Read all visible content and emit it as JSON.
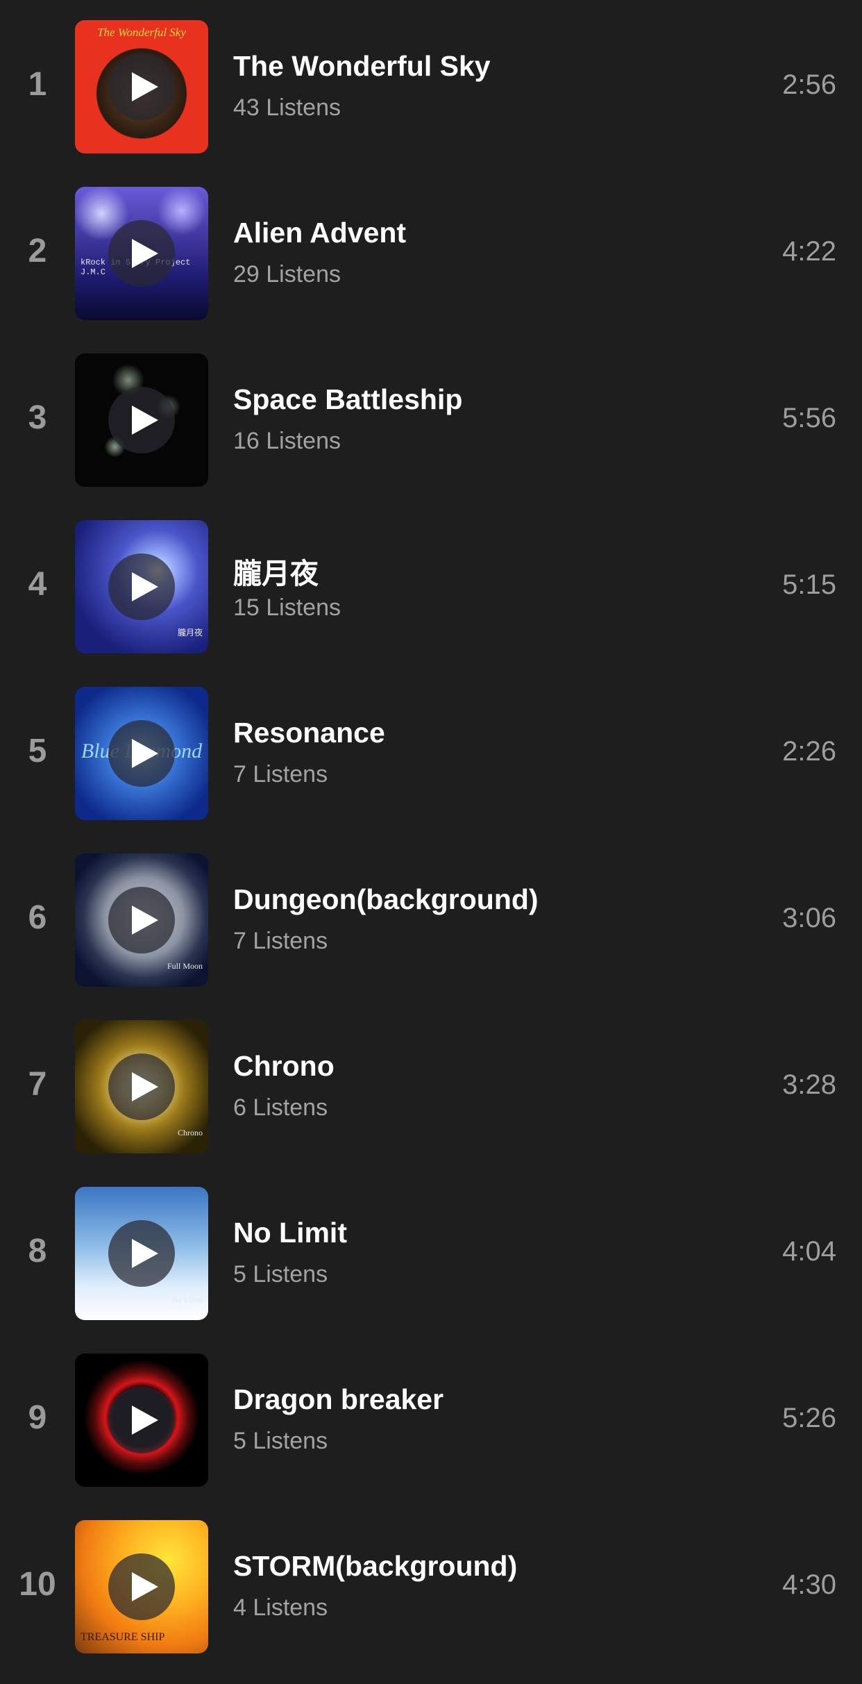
{
  "tracks": [
    {
      "rank": "1",
      "title": "The Wonderful Sky",
      "listens": "43 Listens",
      "duration": "2:56",
      "art": {
        "caption": "The Wonderful Sky",
        "sub": "",
        "colors": [
          "#e8321f",
          "#2a1a10"
        ]
      }
    },
    {
      "rank": "2",
      "title": "Alien Advent",
      "listens": "29 Listens",
      "duration": "4:22",
      "art": {
        "caption": "",
        "sub": "kRock in Story Project J.M.C",
        "colors": [
          "#1c1a6e",
          "#6a5ad8"
        ]
      }
    },
    {
      "rank": "3",
      "title": "Space Battleship",
      "listens": "16 Listens",
      "duration": "5:56",
      "art": {
        "caption": "",
        "sub": "",
        "colors": [
          "#050505",
          "#3a4a3a"
        ]
      }
    },
    {
      "rank": "4",
      "title": "朧月夜",
      "listens": "15 Listens",
      "duration": "5:15",
      "art": {
        "caption": "",
        "sub": "朧月夜",
        "colors": [
          "#1a1f7a",
          "#9db4ff"
        ]
      }
    },
    {
      "rank": "5",
      "title": "Resonance",
      "listens": "7 Listens",
      "duration": "2:26",
      "art": {
        "caption": "Blue Diamond",
        "sub": "",
        "colors": [
          "#0d2a8a",
          "#3f7ee0"
        ]
      }
    },
    {
      "rank": "6",
      "title": "Dungeon(background)",
      "listens": "7 Listens",
      "duration": "3:06",
      "art": {
        "caption": "",
        "sub": "Full Moon",
        "colors": [
          "#0b1330",
          "#c9ced8"
        ]
      }
    },
    {
      "rank": "7",
      "title": "Chrono",
      "listens": "6 Listens",
      "duration": "3:28",
      "art": {
        "caption": "",
        "sub": "Chrono",
        "colors": [
          "#2b2206",
          "#f4e08a"
        ]
      }
    },
    {
      "rank": "8",
      "title": "No Limit",
      "listens": "5 Listens",
      "duration": "4:04",
      "art": {
        "caption": "",
        "sub": "No Limit",
        "colors": [
          "#3a76c4",
          "#dfeefc"
        ]
      }
    },
    {
      "rank": "9",
      "title": "Dragon breaker",
      "listens": "5 Listens",
      "duration": "5:26",
      "art": {
        "caption": "",
        "sub": "",
        "colors": [
          "#000000",
          "#d4161a"
        ]
      }
    },
    {
      "rank": "10",
      "title": "STORM(background)",
      "listens": "4 Listens",
      "duration": "4:30",
      "art": {
        "caption": "",
        "sub": "TREASURE SHIP",
        "colors": [
          "#f07a12",
          "#ffe63a"
        ]
      }
    }
  ],
  "icons": {
    "play": "play-icon"
  }
}
